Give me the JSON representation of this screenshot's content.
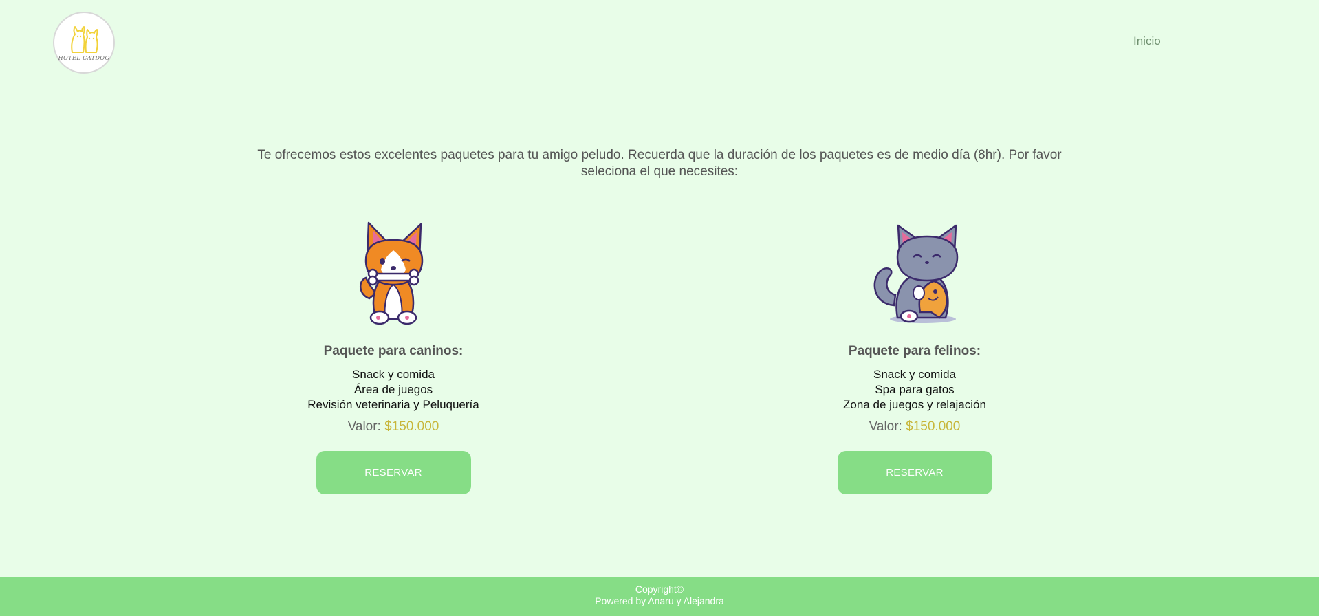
{
  "header": {
    "logo_text": "HOTEL CATDOG",
    "nav": {
      "home_label": "Inicio"
    }
  },
  "intro": {
    "text": "Te ofrecemos estos excelentes paquetes para tu amigo peludo. Recuerda que la duración de los paquetes es de medio día (8hr). Por favor seleciona el que necesites:"
  },
  "packages": [
    {
      "image_icon": "corgi-dog-icon",
      "title": "Paquete para caninos:",
      "features": [
        "Snack y comida",
        "Área de juegos",
        "Revisión veterinaria y Peluquería"
      ],
      "price_label": "Valor:",
      "price_value": "$150.000",
      "button_label": "RESERVAR"
    },
    {
      "image_icon": "cat-with-fish-icon",
      "title": "Paquete para felinos:",
      "features": [
        "Snack y comida",
        "Spa para gatos",
        "Zona de juegos y relajación"
      ],
      "price_label": "Valor:",
      "price_value": "$150.000",
      "button_label": "RESERVAR"
    }
  ],
  "footer": {
    "copyright": "Copyright©",
    "powered_by": "Powered by Anaru y Alejandra"
  },
  "colors": {
    "background": "#e8fde8",
    "accent_green": "#86dd86",
    "price_gold": "#c8b63a",
    "text_gray": "#555555"
  }
}
